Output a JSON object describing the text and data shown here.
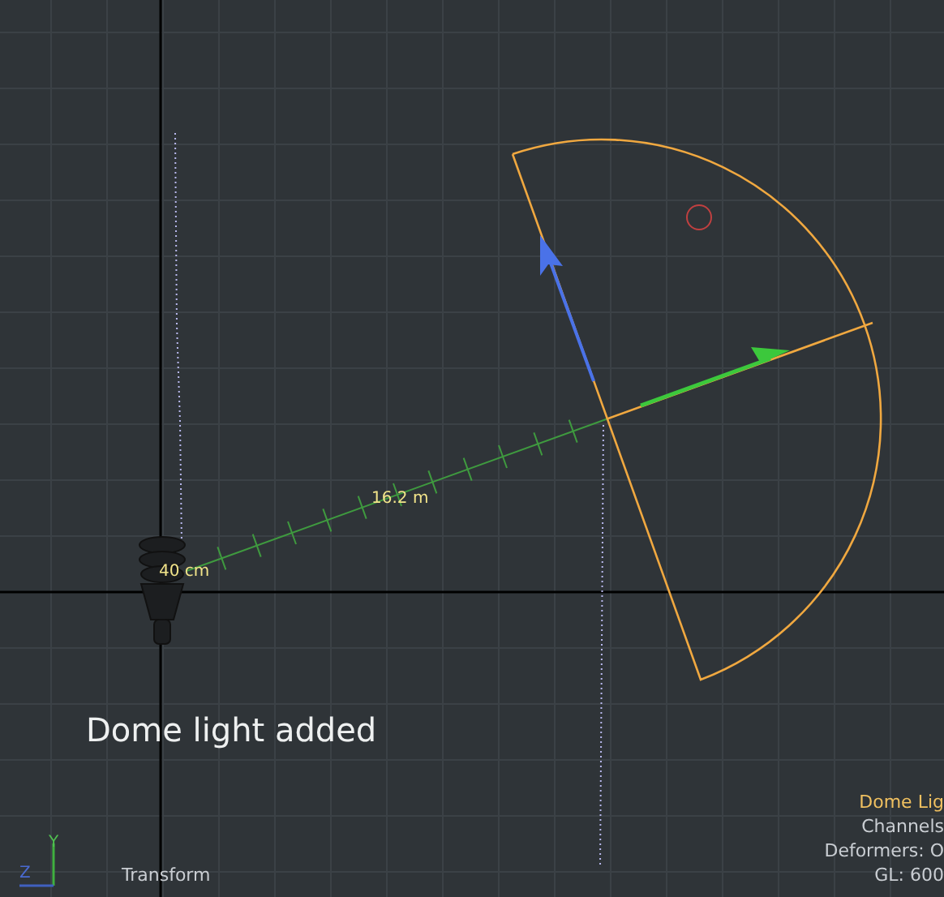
{
  "viewport": {
    "measurements": [
      {
        "text": "40 cm",
        "kind": "near"
      },
      {
        "text": "16.2 m",
        "kind": "distance"
      }
    ],
    "message": "Dome light added",
    "tool": "Transform",
    "axes": [
      {
        "label": "Y",
        "kind": "y"
      },
      {
        "label": "Z",
        "kind": "z"
      }
    ],
    "info": [
      {
        "text": "Dome Lig",
        "kind": "title"
      },
      {
        "text": "Channels",
        "kind": "line"
      },
      {
        "text": "Deformers: O",
        "kind": "line"
      },
      {
        "text": "GL: 600",
        "kind": "line"
      }
    ]
  }
}
